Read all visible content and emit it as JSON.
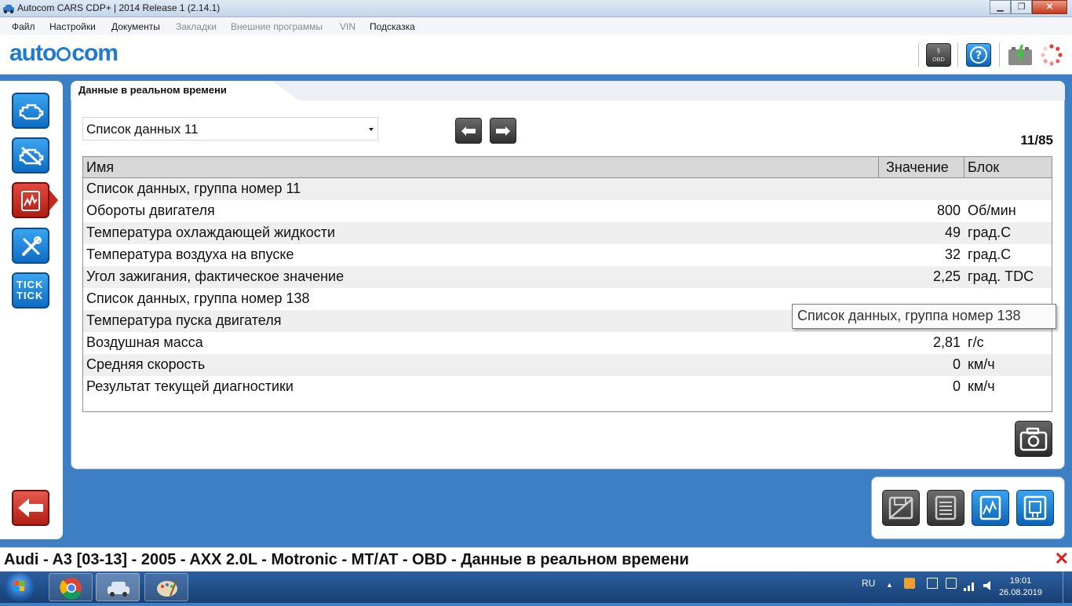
{
  "window": {
    "title": "Autocom CARS CDP+ | 2014 Release 1 (2.14.1)",
    "minimize": "▁",
    "maximize": "❐",
    "close": "✕"
  },
  "menu": {
    "file": "Файл",
    "settings": "Настройки",
    "documents": "Документы",
    "bookmarks": "Закладки",
    "external": "Внешние программы",
    "vin": "VIN",
    "help": "Подсказка"
  },
  "logo": {
    "left": "auto",
    "right": "com"
  },
  "tab": {
    "label": "Данные в реальном времени"
  },
  "list_select": {
    "value": "Список данных 11"
  },
  "counter": "11/85",
  "grid": {
    "headers": {
      "name": "Имя",
      "value": "Значение",
      "unit": "Блок"
    },
    "rows": [
      {
        "name": "Список данных, группа номер 11",
        "value": "",
        "unit": ""
      },
      {
        "name": "Обороты двигателя",
        "value": "800",
        "unit": "Об/мин"
      },
      {
        "name": "Температура охлаждающей жидкости",
        "value": "49",
        "unit": "град.C"
      },
      {
        "name": "Температура воздуха на впуске",
        "value": "32",
        "unit": "град.C"
      },
      {
        "name": "Угол зажигания, фактическое значение",
        "value": "2,25",
        "unit": "град. TDC"
      },
      {
        "name": "Список данных, группа номер 138",
        "value": "",
        "unit": ""
      },
      {
        "name": "Температура пуска двигателя",
        "value": "",
        "unit": ""
      },
      {
        "name": "Воздушная масса",
        "value": "2,81",
        "unit": "г/с"
      },
      {
        "name": "Средняя скорость",
        "value": "0",
        "unit": "км/ч"
      },
      {
        "name": "Результат текущей диагностики",
        "value": "0",
        "unit": "км/ч"
      }
    ]
  },
  "tooltip": "Список данных, группа номер 138",
  "sidebar": {
    "tick_label": "TICK TICK"
  },
  "status": {
    "vehicle": "Audi - A3 [03-13] - 2005 - AXX 2.0L - Motronic - MT/AT - OBD - Данные в реальном времени"
  },
  "taskbar": {
    "lang": "RU",
    "time": "19:01",
    "date": "26.08.2019"
  },
  "colors": {
    "brand": "#1e7ad0",
    "accent_red": "#c8281c",
    "panel_bg": "#3c7fc4"
  }
}
